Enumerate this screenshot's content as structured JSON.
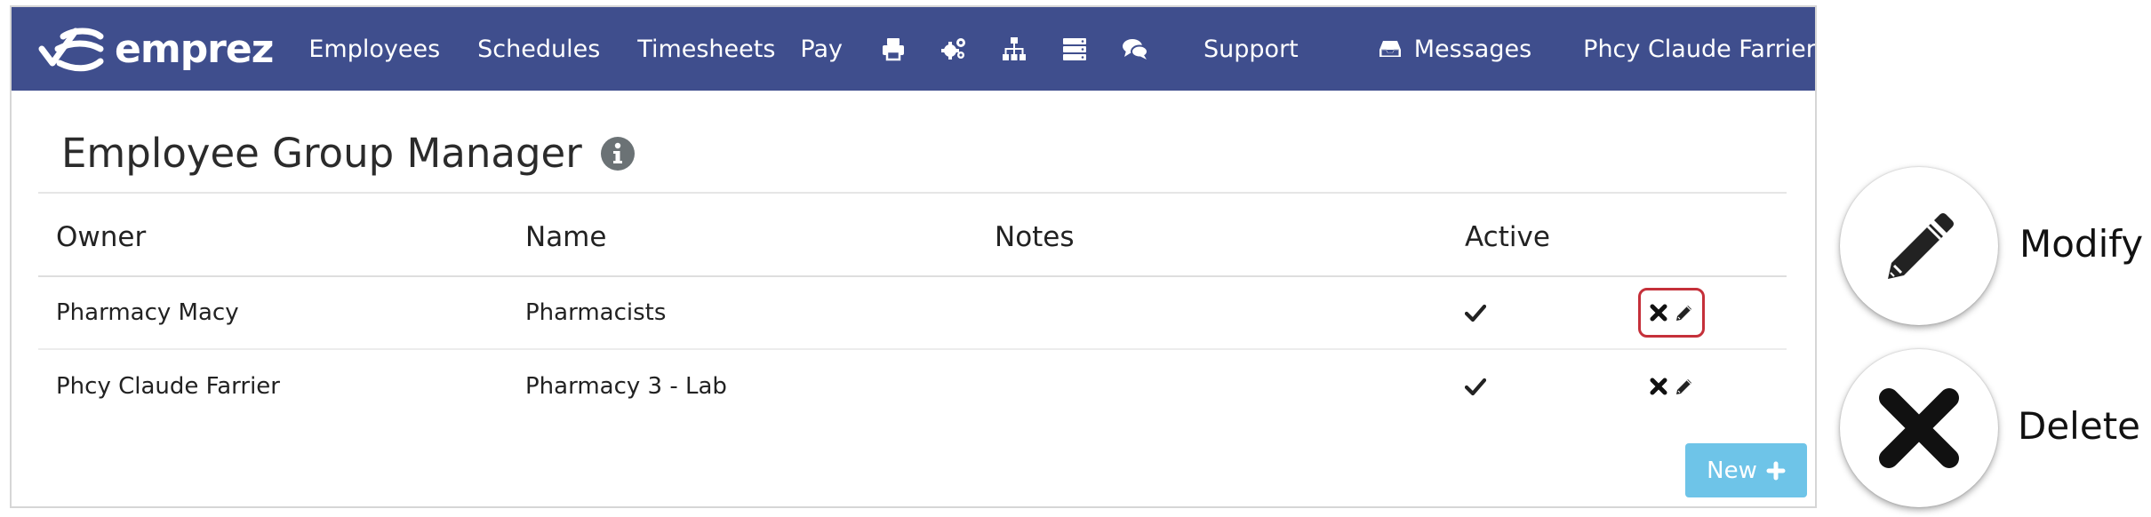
{
  "brand": {
    "name": "emprez"
  },
  "nav": {
    "employees": "Employees",
    "schedules": "Schedules",
    "timesheets": "Timesheets",
    "pay": "Pay",
    "icons": [
      "print-icon",
      "cogs-icon",
      "sitemap-icon",
      "server-icon",
      "comments-icon"
    ],
    "support": "Support",
    "messages": "Messages",
    "user": "Phcy Claude Farrier"
  },
  "page": {
    "title": "Employee Group Manager"
  },
  "table": {
    "headers": {
      "owner": "Owner",
      "name": "Name",
      "notes": "Notes",
      "active": "Active"
    },
    "rows": [
      {
        "owner": "Pharmacy Macy",
        "name": "Pharmacists",
        "notes": "",
        "active": true,
        "highlighted": true
      },
      {
        "owner": "Phcy Claude Farrier",
        "name": "Pharmacy 3 - Lab",
        "notes": "",
        "active": true,
        "highlighted": false
      }
    ]
  },
  "new_button": {
    "label": "New"
  },
  "legend": {
    "modify": "Modify",
    "delete": "Delete"
  },
  "colors": {
    "navbar": "#3f4e8d",
    "new_button": "#6ec4e8",
    "highlight": "#c5303a"
  }
}
